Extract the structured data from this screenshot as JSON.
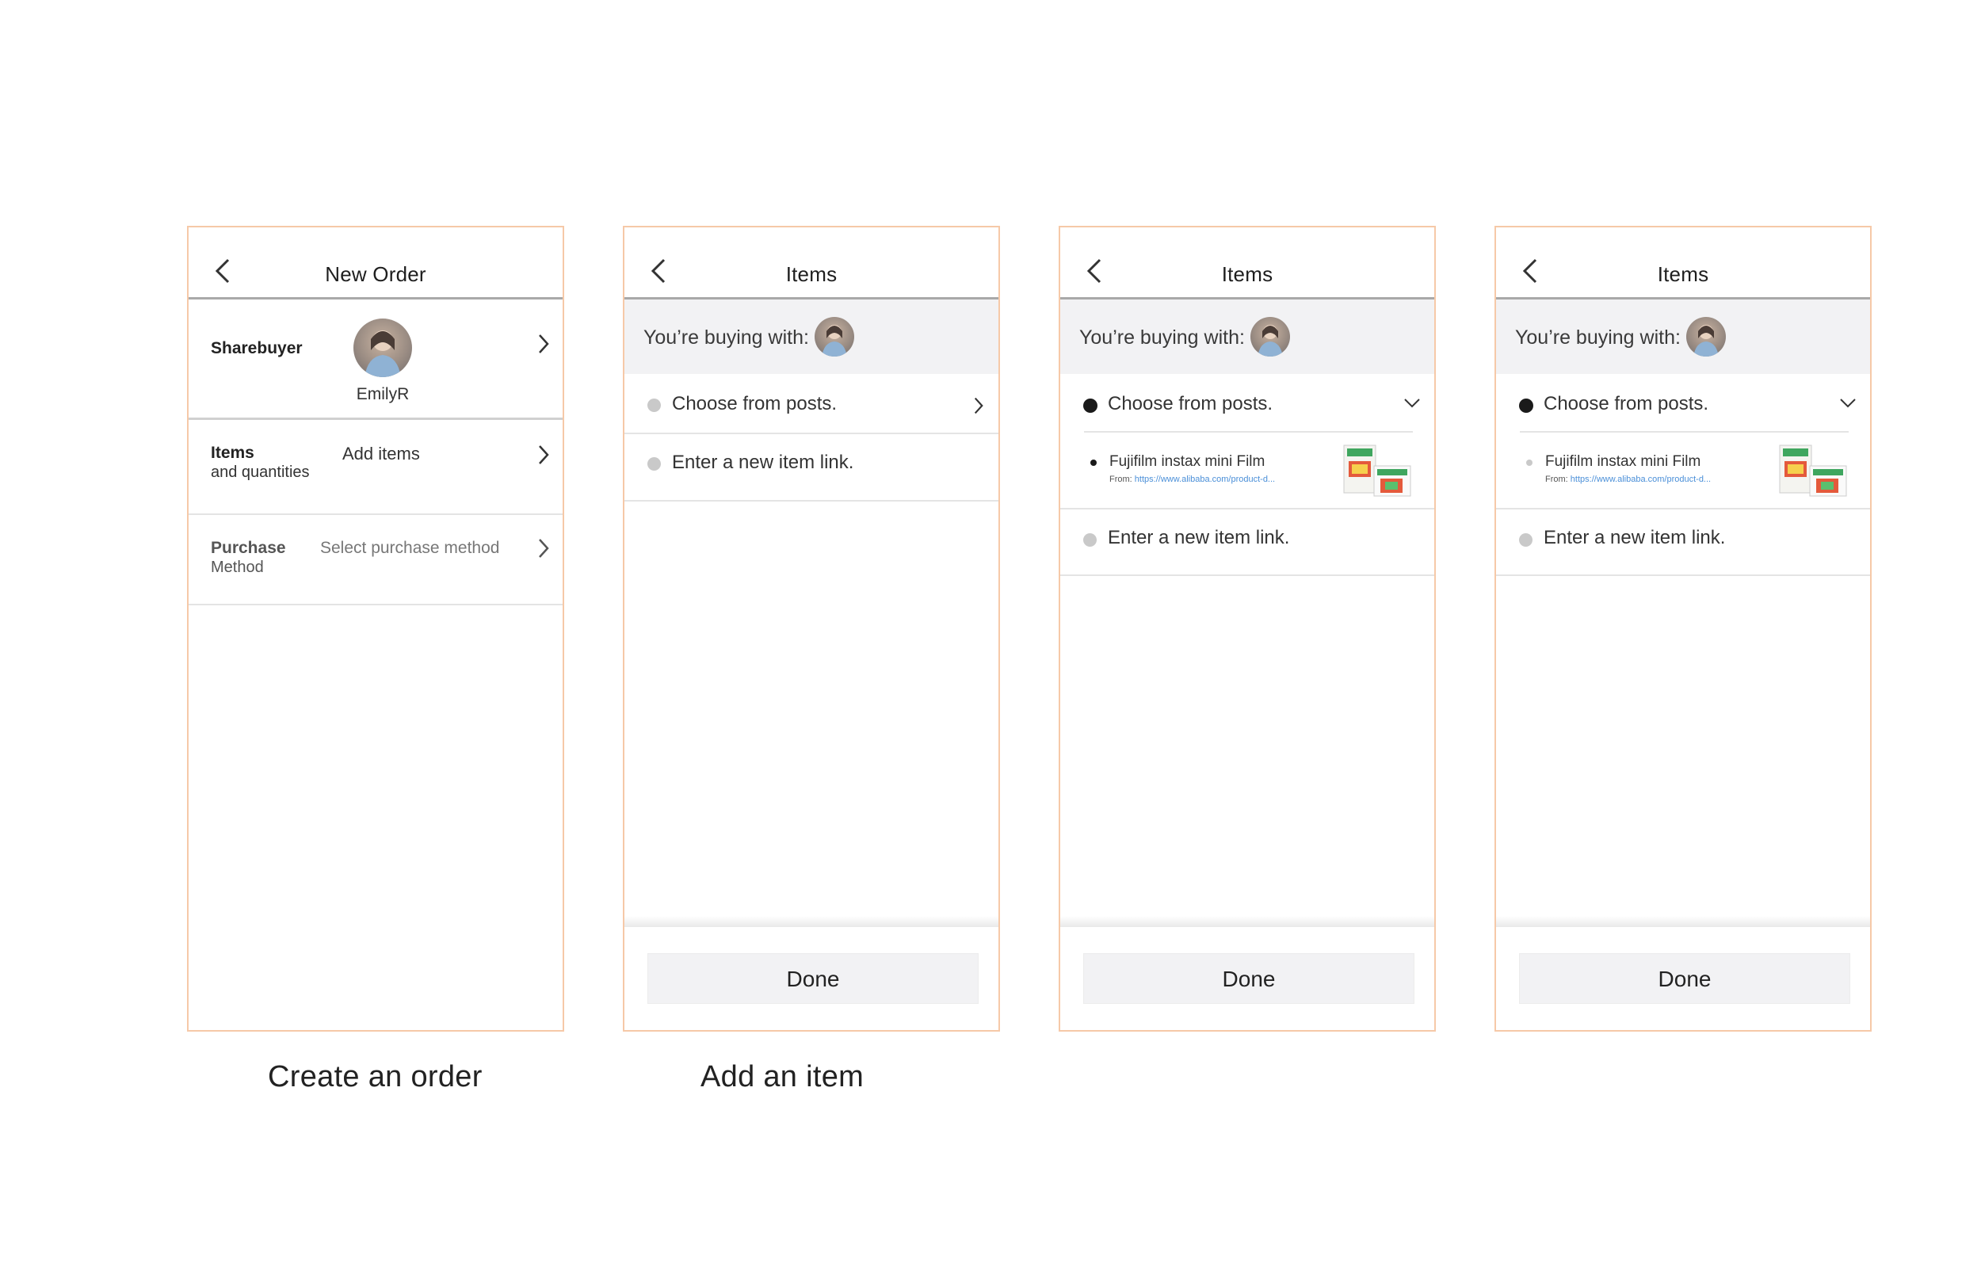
{
  "screens": [
    {
      "title": "New Order",
      "sharebuyer_label": "Sharebuyer",
      "user_name": "EmilyR",
      "items_label": "Items",
      "items_sub": "and quantities",
      "items_value": "Add items",
      "purchase_label": "Purchase",
      "purchase_sub": "Method",
      "purchase_value": "Select purchase method"
    },
    {
      "title": "Items",
      "buying_with": "You’re buying with:",
      "option_posts": "Choose from posts.",
      "option_link": "Enter a new item link.",
      "done": "Done"
    },
    {
      "title": "Items",
      "buying_with": "You’re buying with:",
      "option_posts": "Choose from posts.",
      "item_name": "Fujifilm instax mini Film",
      "item_from_label": "From:",
      "item_from_url": "https://www.alibaba.com/product-d...",
      "option_link": "Enter a new item link.",
      "done": "Done"
    },
    {
      "title": "Items",
      "buying_with": "You’re buying with:",
      "option_posts": "Choose from posts.",
      "item_name": "Fujifilm instax mini Film",
      "item_from_label": "From:",
      "item_from_url": "https://www.alibaba.com/product-d...",
      "option_link": "Enter a new item link.",
      "done": "Done"
    }
  ],
  "captions": [
    "Create an order",
    "Add an item"
  ],
  "colors": {
    "frame_border": "#f6c9a8",
    "link": "#4a8fd8",
    "band": "#f2f2f4"
  },
  "icons": [
    "back-arrow-icon",
    "chevron-right-icon",
    "chevron-down-icon",
    "avatar"
  ]
}
